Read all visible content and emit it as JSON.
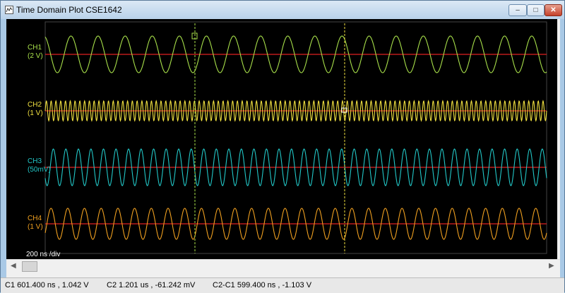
{
  "window": {
    "title": "Time Domain Plot CSE1642",
    "minimize_glyph": "–",
    "maximize_glyph": "□",
    "close_glyph": "✕"
  },
  "plot": {
    "background_color": "#000000",
    "time_per_div": "200 ns /div",
    "channels": [
      {
        "name": "CH1",
        "scale": "(2 V)",
        "color": "#a8e04a",
        "cycles": 18.5
      },
      {
        "name": "CH2",
        "scale": "(1 V)",
        "color": "#f0e040",
        "cycles": 105
      },
      {
        "name": "CH3",
        "scale": "(50mV)",
        "color": "#22c8c8",
        "cycles": 40
      },
      {
        "name": "CH4",
        "scale": "(1 V)",
        "color": "#f0a020",
        "cycles": 30
      }
    ],
    "reference_line_color": "#e02020",
    "cursor1_color": "#a8e04a",
    "cursor2_color": "#f0e040"
  },
  "scrollbar": {
    "left_arrow": "◀",
    "right_arrow": "▶"
  },
  "status": {
    "c1": "C1  601.400 ns , 1.042 V",
    "c2": "C2  1.201 us , -61.242 mV",
    "diff": "C2-C1  599.400 ns , -1.103 V"
  }
}
